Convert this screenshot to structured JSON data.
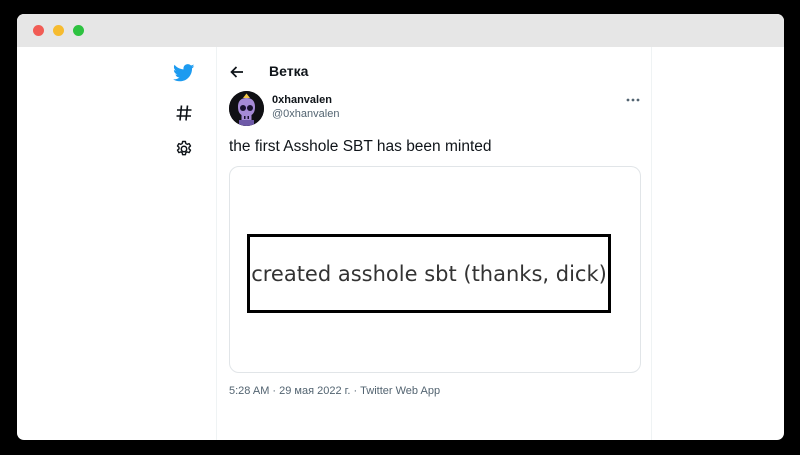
{
  "colors": {
    "twitter_blue": "#1d9bf0",
    "text_primary": "#0f1419",
    "text_secondary": "#536471"
  },
  "sidebar": {
    "icons": [
      "twitter-logo-icon",
      "hashtag-icon",
      "gear-icon"
    ]
  },
  "header": {
    "title": "Ветка"
  },
  "tweet": {
    "author_name": "0xhanvalen",
    "author_handle": "@0xhanvalen",
    "text": "the first Asshole SBT has been minted",
    "media_caption": "created asshole sbt (thanks, dick)",
    "time": "5:28 AM",
    "date": "29 мая 2022 г.",
    "source": "Twitter Web App",
    "separator": " · "
  }
}
